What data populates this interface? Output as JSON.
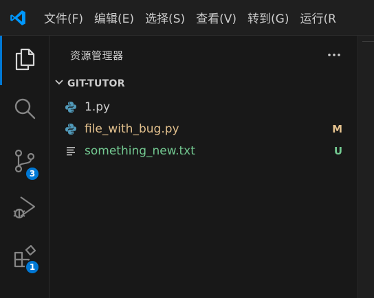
{
  "menu": {
    "items": [
      {
        "label": "文件(F)"
      },
      {
        "label": "编辑(E)"
      },
      {
        "label": "选择(S)"
      },
      {
        "label": "查看(V)"
      },
      {
        "label": "转到(G)"
      },
      {
        "label": "运行(R"
      }
    ]
  },
  "activity": {
    "items": [
      {
        "name": "explorer",
        "icon": "files-icon",
        "active": true
      },
      {
        "name": "search",
        "icon": "search-icon"
      },
      {
        "name": "source-control",
        "icon": "source-control-icon",
        "badge": "3"
      },
      {
        "name": "run-debug",
        "icon": "run-debug-icon"
      },
      {
        "name": "extensions",
        "icon": "extensions-icon",
        "badge": "1"
      }
    ]
  },
  "sidebar": {
    "title": "资源管理器",
    "more_icon": "ellipsis-icon",
    "section": {
      "title": "GIT-TUTOR",
      "expanded": true
    },
    "files": [
      {
        "name": "1.py",
        "icon": "python-icon",
        "status": "",
        "color": "#cccccc"
      },
      {
        "name": "file_with_bug.py",
        "icon": "python-icon",
        "status": "M",
        "color": "#e2c08d"
      },
      {
        "name": "something_new.txt",
        "icon": "text-file-icon",
        "status": "U",
        "color": "#73c991"
      }
    ]
  },
  "colors": {
    "accent": "#0078d4",
    "modified": "#e2c08d",
    "untracked": "#73c991"
  }
}
